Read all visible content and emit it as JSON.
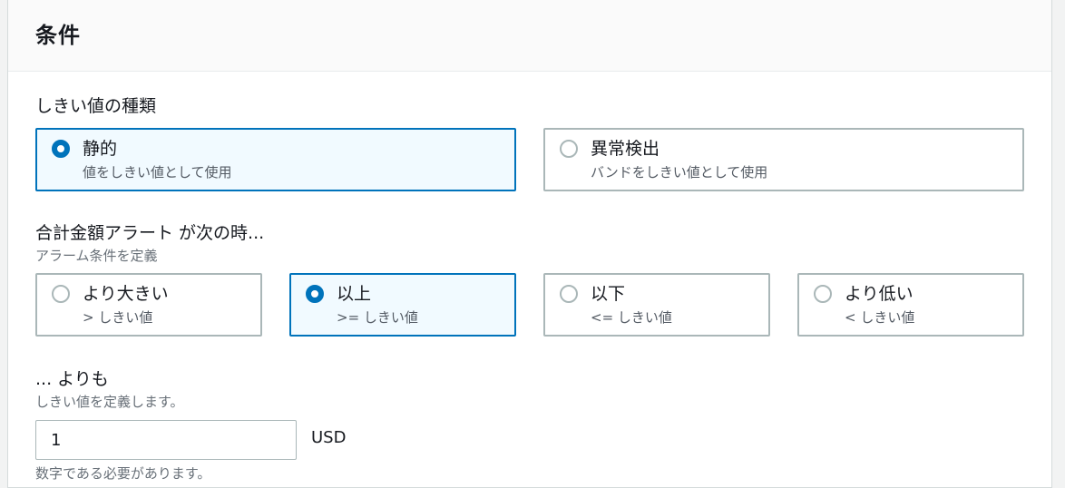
{
  "panel": {
    "title": "条件"
  },
  "threshold_type": {
    "label": "しきい値の種類",
    "options": [
      {
        "label": "静的",
        "description": "値をしきい値として使用",
        "selected": true
      },
      {
        "label": "異常検出",
        "description": "バンドをしきい値として使用",
        "selected": false
      }
    ]
  },
  "condition": {
    "label": "合計金額アラート が次の時...",
    "description": "アラーム条件を定義",
    "options": [
      {
        "label": "より大きい",
        "description": "> しきい値",
        "selected": false
      },
      {
        "label": "以上",
        "description": ">= しきい値",
        "selected": true
      },
      {
        "label": "以下",
        "description": "<= しきい値",
        "selected": false
      },
      {
        "label": "より低い",
        "description": "< しきい値",
        "selected": false
      }
    ]
  },
  "threshold_value": {
    "label": "... よりも",
    "description": "しきい値を定義します。",
    "value": "1",
    "unit": "USD",
    "constraint": "数字である必要があります。"
  },
  "colors": {
    "accent": "#0073bb",
    "selected_background": "#f1faff",
    "border": "#aab7b8"
  }
}
